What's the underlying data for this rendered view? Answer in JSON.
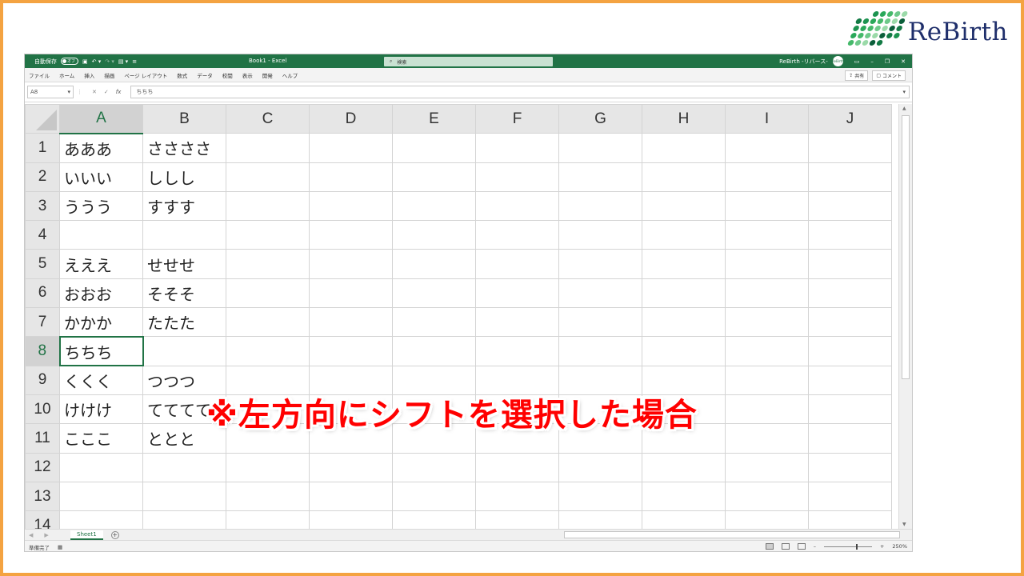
{
  "logo": {
    "text": "ReBirth"
  },
  "excel": {
    "titlebar": {
      "autosave_label": "自動保存",
      "autosave_state": "オフ",
      "doc_title": "Book1  -  Excel",
      "search_placeholder": "検索",
      "user": "ReBirth -リバース-",
      "avatar_text": "ReBirth"
    },
    "ribbon_tabs": [
      "ファイル",
      "ホーム",
      "挿入",
      "描画",
      "ページ レイアウト",
      "数式",
      "データ",
      "校閲",
      "表示",
      "開発",
      "ヘルプ"
    ],
    "share_label": "共有",
    "comment_label": "コメント",
    "formula_bar": {
      "name_box": "A8",
      "content": "ちちち",
      "fx": "fx"
    },
    "columns": [
      "A",
      "B",
      "C",
      "D",
      "E",
      "F",
      "G",
      "H",
      "I",
      "J"
    ],
    "active_column": "A",
    "active_row": "8",
    "rows": [
      {
        "num": "1",
        "a": "あああ",
        "b": "ささささ"
      },
      {
        "num": "2",
        "a": "いいい",
        "b": "ししし"
      },
      {
        "num": "3",
        "a": "ううう",
        "b": "すすす"
      },
      {
        "num": "4",
        "a": "",
        "b": ""
      },
      {
        "num": "5",
        "a": "えええ",
        "b": "せせせ"
      },
      {
        "num": "6",
        "a": "おおお",
        "b": "そそそ"
      },
      {
        "num": "7",
        "a": "かかか",
        "b": "たたた"
      },
      {
        "num": "8",
        "a": "ちちち",
        "b": ""
      },
      {
        "num": "9",
        "a": "くくく",
        "b": "つつつ"
      },
      {
        "num": "10",
        "a": "けけけ",
        "b": "てててて"
      },
      {
        "num": "11",
        "a": "こここ",
        "b": "ととと"
      },
      {
        "num": "12",
        "a": "",
        "b": ""
      },
      {
        "num": "13",
        "a": "",
        "b": ""
      },
      {
        "num": "14",
        "a": "",
        "b": ""
      }
    ],
    "sheet_tab": "Sheet1",
    "status": {
      "ready": "準備完了",
      "zoom": "250%"
    }
  },
  "overlay_text": "※左方向にシフトを選択した場合",
  "colors": {
    "excel_green": "#217346",
    "frame_orange": "#f4a341",
    "overlay_red": "#ff0000"
  }
}
